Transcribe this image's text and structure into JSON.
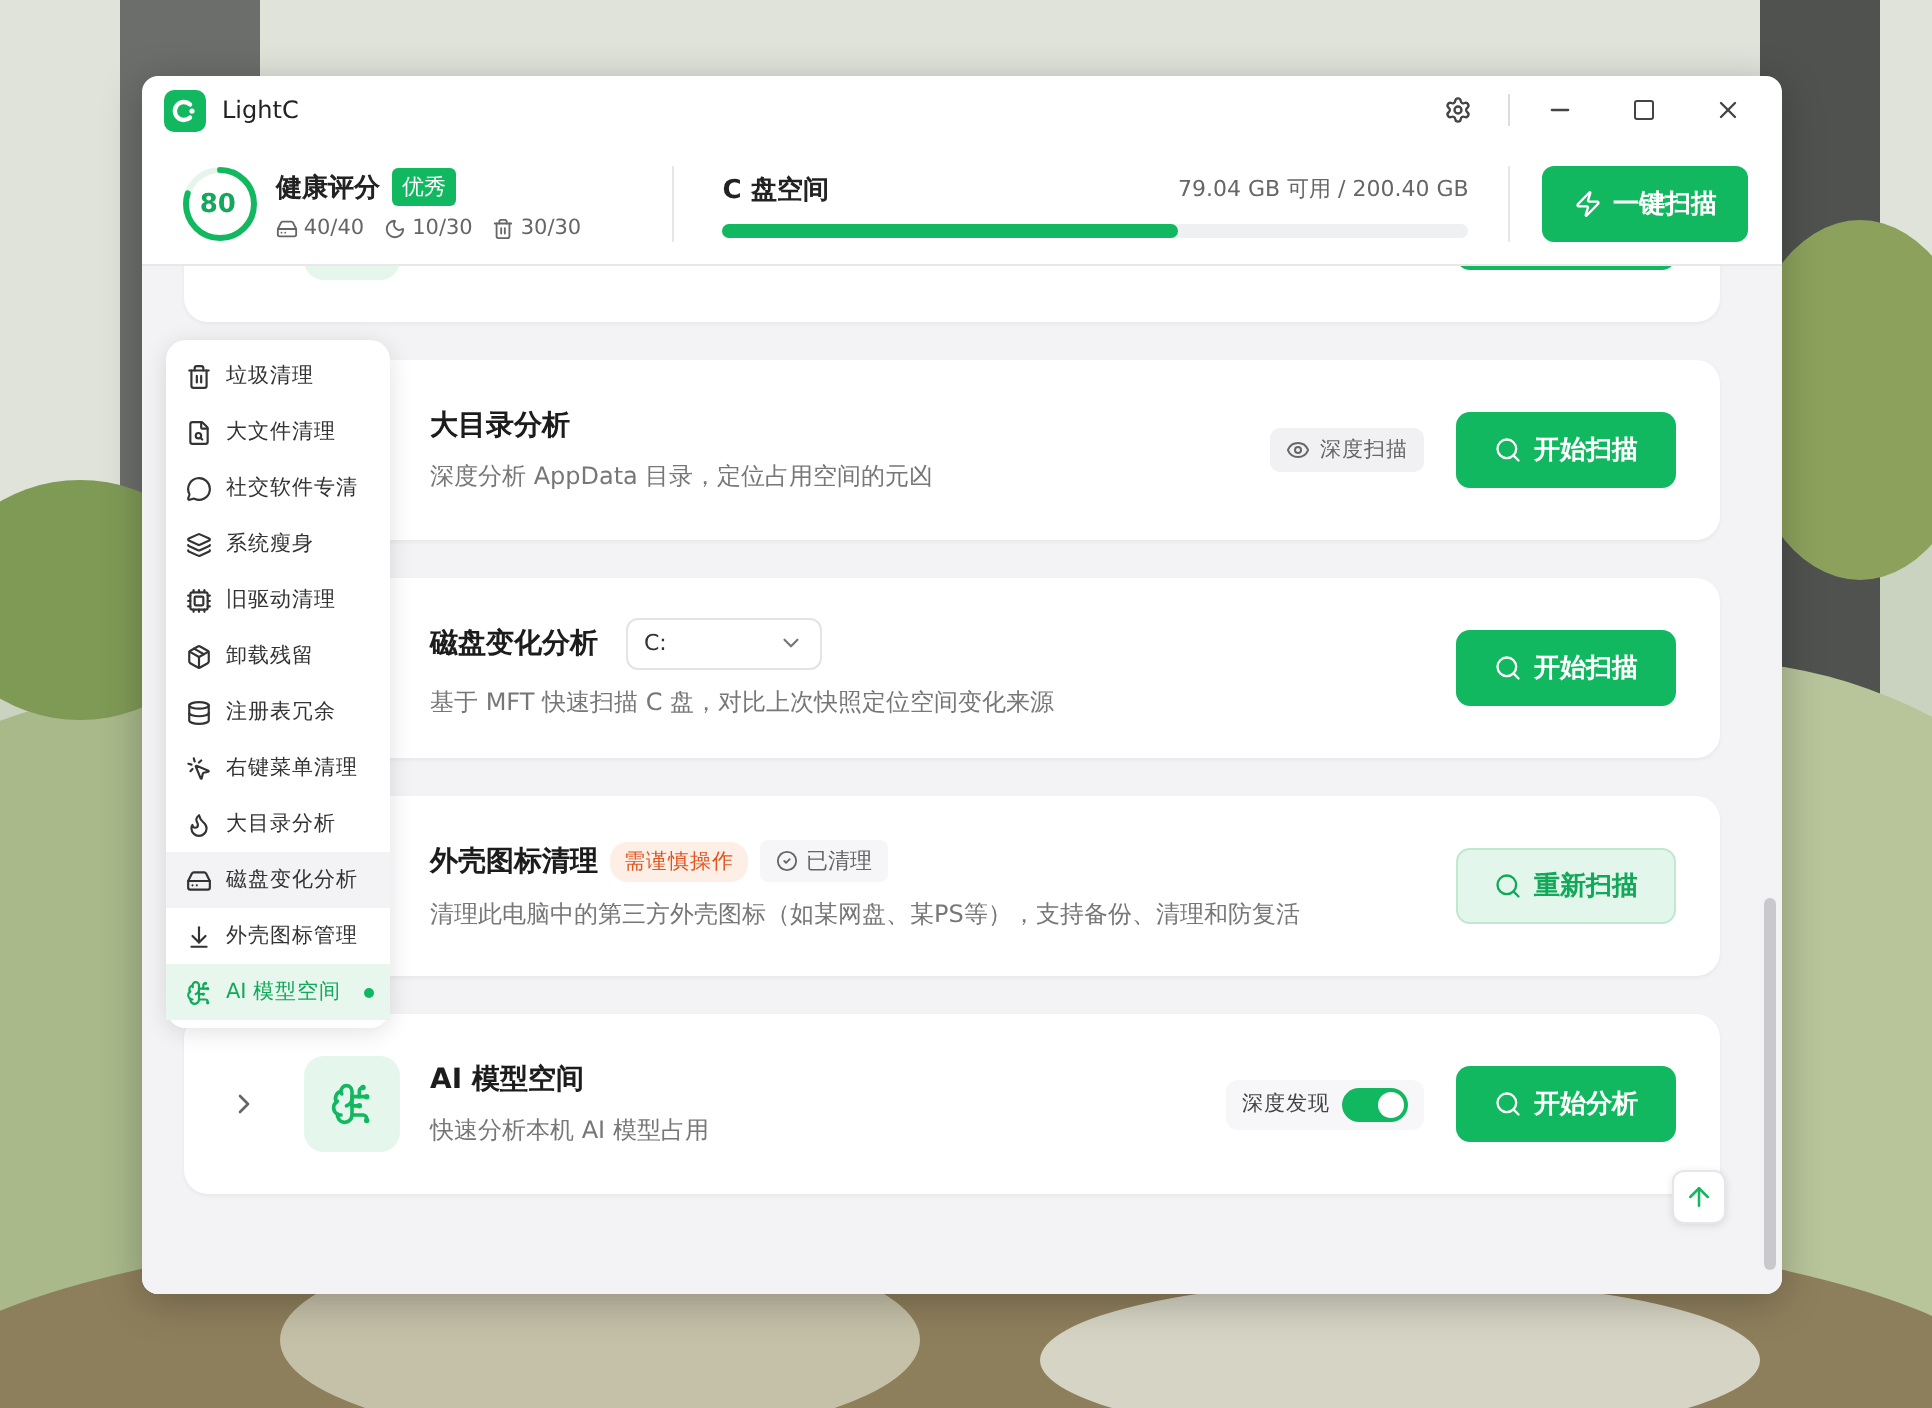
{
  "window": {
    "title": "LightC"
  },
  "health": {
    "score": "80",
    "level": 0.8,
    "label": "健康评分",
    "badge": "优秀",
    "stats": [
      "40/40",
      "10/30",
      "30/30"
    ]
  },
  "disk": {
    "title": "C 盘空间",
    "reading": "79.04 GB 可用 / 200.40 GB",
    "level": 0.61
  },
  "scan_all_button": "一键扫描",
  "cards": [
    {
      "title": "大目录分析",
      "description": "深度分析 AppData 目录，定位占用空间的元凶",
      "tags": [
        {
          "kind": "chip",
          "text": "深度扫描"
        }
      ],
      "button": {
        "label": "开始扫描",
        "kind": "primary"
      }
    },
    {
      "title": "磁盘变化分析",
      "selector": "C:",
      "description": "基于 MFT 快速扫描 C 盘，对比上次快照定位空间变化来源",
      "button": {
        "label": "开始扫描",
        "kind": "primary"
      }
    },
    {
      "title": "外壳图标清理",
      "tags": [
        {
          "kind": "warning",
          "text": "需谨慎操作"
        },
        {
          "kind": "status",
          "text": "已清理"
        }
      ],
      "description": "清理此电脑中的第三方外壳图标（如某网盘、某PS等），支持备份、清理和防复活",
      "button": {
        "label": "重新扫描",
        "kind": "secondary"
      }
    },
    {
      "title": "AI 模型空间",
      "expanded": false,
      "description": "快速分析本机 AI 模型占用",
      "toggle": {
        "label": "深度发现",
        "on": true
      },
      "button": {
        "label": "开始分析",
        "kind": "primary"
      }
    }
  ],
  "menu": [
    {
      "label": "垃圾清理",
      "selected": false,
      "hovered": false
    },
    {
      "label": "大文件清理",
      "selected": false,
      "hovered": false
    },
    {
      "label": "社交软件专清",
      "selected": false,
      "hovered": false
    },
    {
      "label": "系统瘦身",
      "selected": false,
      "hovered": false
    },
    {
      "label": "旧驱动清理",
      "selected": false,
      "hovered": false
    },
    {
      "label": "卸载残留",
      "selected": false,
      "hovered": false
    },
    {
      "label": "注册表冗余",
      "selected": false,
      "hovered": false
    },
    {
      "label": "右键菜单清理",
      "selected": false,
      "hovered": false
    },
    {
      "label": "大目录分析",
      "selected": false,
      "hovered": false
    },
    {
      "label": "磁盘变化分析",
      "selected": false,
      "hovered": true
    },
    {
      "label": "外壳图标管理",
      "selected": false,
      "hovered": false
    },
    {
      "label": "AI 模型空间",
      "selected": true,
      "hovered": false
    }
  ]
}
